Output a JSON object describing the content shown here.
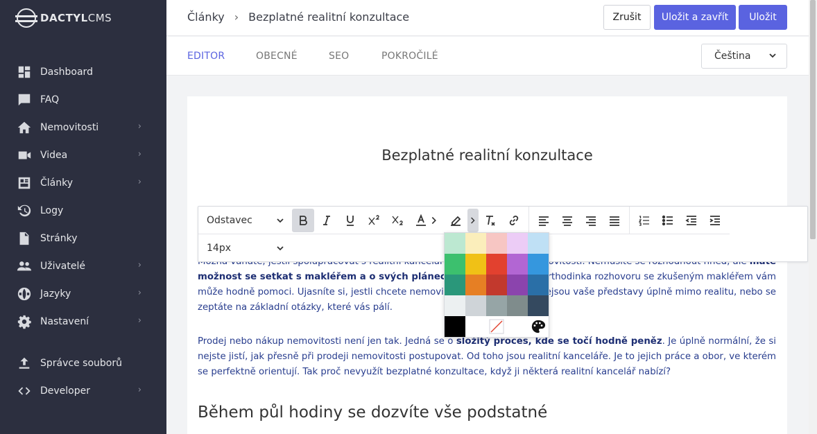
{
  "app": {
    "logo_bold": "DACTYL",
    "logo_light": "CMS"
  },
  "sidebar": {
    "items": [
      {
        "label": "Dashboard",
        "icon": "dashboard-icon",
        "has_children": false
      },
      {
        "label": "FAQ",
        "icon": "chat-icon",
        "has_children": false
      },
      {
        "label": "Nemovitosti",
        "icon": "home-icon",
        "has_children": true
      },
      {
        "label": "Videa",
        "icon": "video-icon",
        "has_children": true
      },
      {
        "label": "Články",
        "icon": "article-icon",
        "has_children": true
      },
      {
        "label": "Logy",
        "icon": "history-icon",
        "has_children": false
      },
      {
        "label": "Stránky",
        "icon": "file-icon",
        "has_children": false
      },
      {
        "label": "Uživatelé",
        "icon": "users-icon",
        "has_children": true
      },
      {
        "label": "Jazyky",
        "icon": "globe-icon",
        "has_children": true
      },
      {
        "label": "Nastavení",
        "icon": "gear-icon",
        "has_children": true
      },
      {
        "label": "Správce souborů",
        "icon": "upload-icon",
        "has_children": false
      },
      {
        "label": "Developer",
        "icon": "code-icon",
        "has_children": true
      }
    ]
  },
  "header": {
    "breadcrumb_parent": "Články",
    "breadcrumb_sep": "›",
    "breadcrumb_current": "Bezplatné realitní konzultace",
    "cancel_label": "Zrušit",
    "save_close_label": "Uložit a zavřít",
    "save_label": "Uložit"
  },
  "tabs": {
    "items": [
      "EDITOR",
      "OBECNÉ",
      "SEO",
      "POKROČILÉ"
    ],
    "active": "EDITOR",
    "language": "Čeština"
  },
  "editor": {
    "block_format": "Odstavec",
    "font_size": "14px",
    "title": "Bezplatné realitní konzultace",
    "para1_line1_a": "Možná váháte, jestli spolupracovat s realitní kanceláří p",
    "para1_line1_b": "nemovitosti. Nemusíte se rozhodnout hned, ale ",
    "para1_bold_a": "máte",
    "para1_line2_bold": "možnost se setkat s makléřem a o svých plánech si nezáv",
    "para1_line2_b": "čtvrthodinka rozhovoru se zkušeným makléřem vám",
    "para1_line3_a": "může hodně pomoci. Ujasníte si, jestli chcete nemovitos",
    "para1_line3_b": "nejsou vaše představy úplně mimo realitu, nebo se",
    "para1_line4": "zeptáte na základní otázky, které vás pálí.",
    "para2_a": "Prodej nebo nákup nemovitosti není jen tak. Jedná se o ",
    "para2_bold": "složitý proces, kde se točí hodně peněz",
    "para2_b": ". Je úplně normální, že si nejste jistí, jak přesně při prodeji nemovitosti postupovat. Od toho jsou realitní kanceláře. Je to jejich práce a obor, ve kterém se perfektně orientují. Tak proč nevyužít bezplatné konzultace, když ji některá realitní kancelář nabízí?",
    "heading2": "Během půl hodiny se dozvíte vše podstatné"
  },
  "palette": {
    "colors": [
      [
        "#bce8d1",
        "#fbeebb",
        "#f7c6c3",
        "#ecccf6",
        "#bfe0f5"
      ],
      [
        "#3cc06e",
        "#f0c116",
        "#e2412f",
        "#b266d3",
        "#3597de"
      ],
      [
        "#2a977a",
        "#e67f24",
        "#c2392d",
        "#8b44ad",
        "#2a6fa7"
      ],
      [
        "#ecf0f1",
        "#cfd4d8",
        "#96a5a6",
        "#7f8c8c",
        "#34495f"
      ],
      [
        "#000000",
        "#ffffff"
      ]
    ],
    "accent": "#5a63e0"
  }
}
